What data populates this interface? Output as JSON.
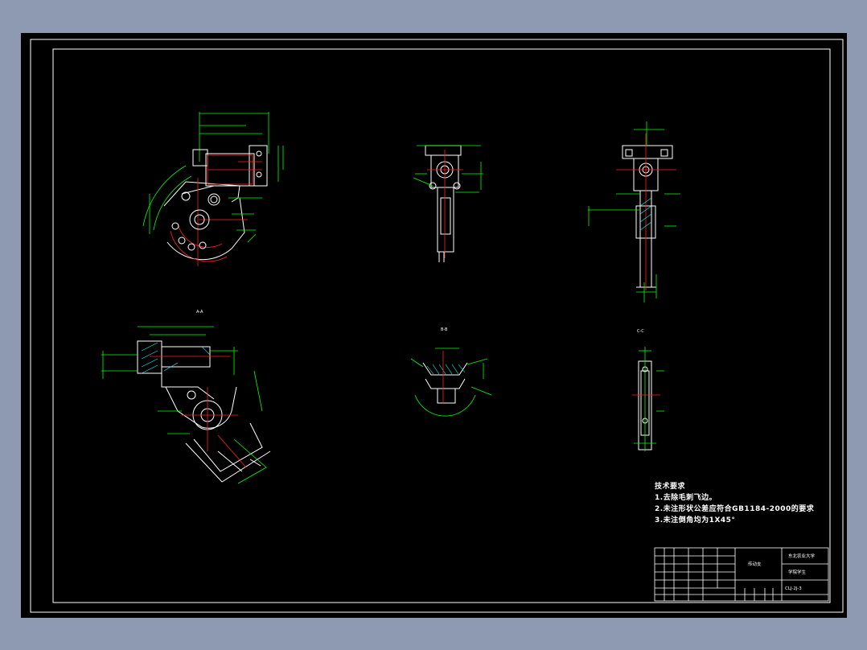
{
  "notes": {
    "heading": "技术要求",
    "lines": [
      "1.去除毛刺飞边。",
      "2.未注形状公差应符合GB1184-2000的要求",
      "3.未注倒角均为1X45°"
    ]
  },
  "title_block": {
    "part_name": "传动支",
    "school": "东北农业大学",
    "dept": "学院学生",
    "drawing_no": "CLJ-2J-3"
  },
  "view_labels": {
    "section_a": "A-A",
    "section_b": "B-B",
    "section_c": "C-C"
  },
  "colors": {
    "border": "#ffffff",
    "outline": "#ffffff",
    "dimension": "#00ff00",
    "centerline": "#ff2020",
    "hatch": "#00ffff",
    "label": "#ffff00"
  }
}
